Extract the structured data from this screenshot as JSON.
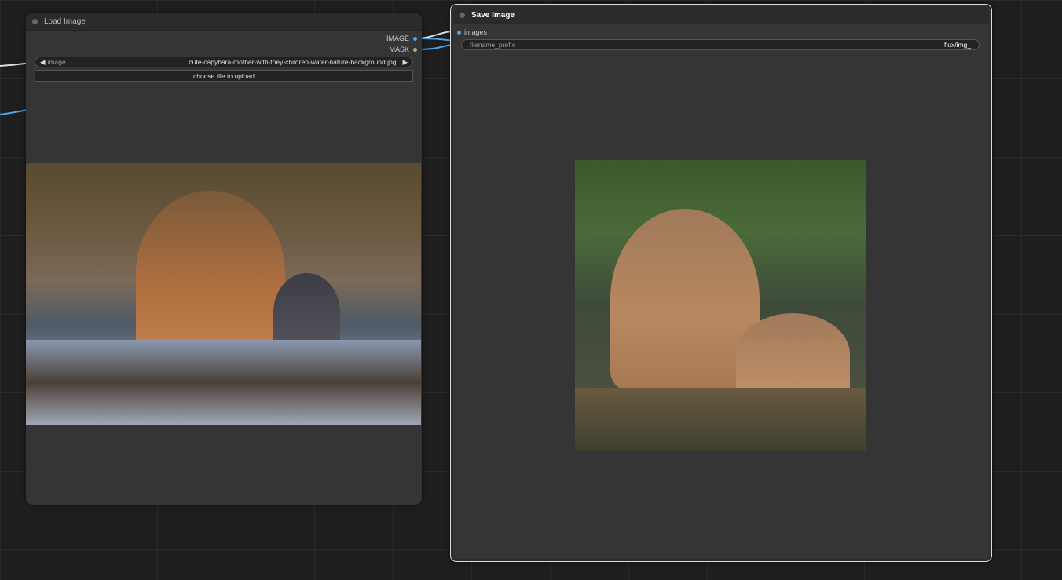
{
  "load_node": {
    "title": "Load Image",
    "outputs": [
      {
        "label": "IMAGE",
        "color": "#4ea4e6"
      },
      {
        "label": "MASK",
        "color": "#7ec46a"
      }
    ],
    "image_widget": {
      "label": "image",
      "value": "cute-capybara-mother-with-they-children-water-nature-background.jpg",
      "prev_icon": "◀",
      "next_icon": "▶"
    },
    "upload_button": "choose file to upload"
  },
  "save_node": {
    "title": "Save Image",
    "input": {
      "label": "images",
      "color": "#4ea4e6"
    },
    "filename_prefix": {
      "label": "filename_prefix",
      "value": "flux/img_"
    }
  }
}
